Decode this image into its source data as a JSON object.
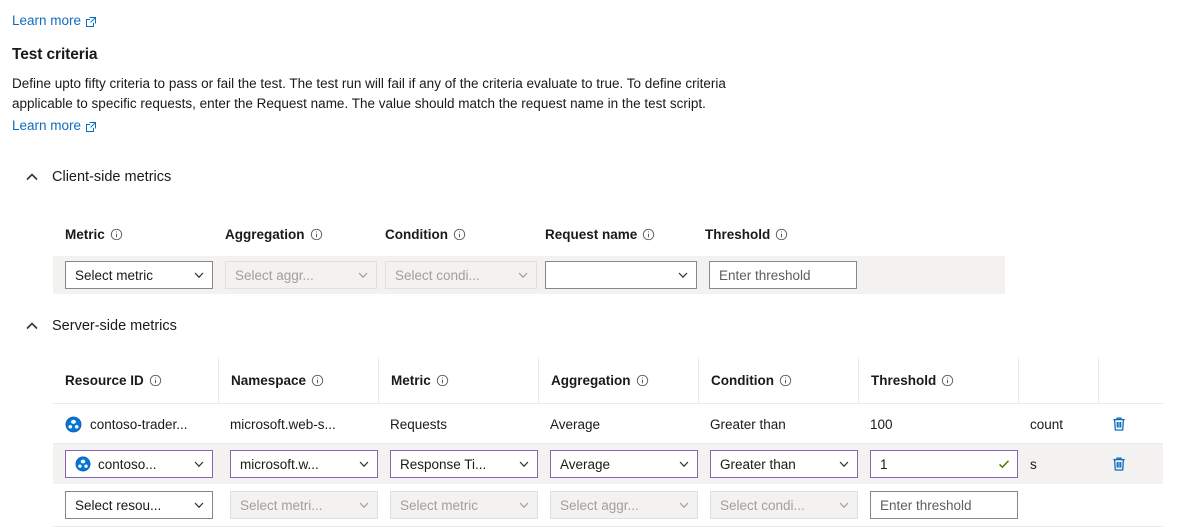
{
  "top_link": {
    "label": "Learn more",
    "icon": "external-link-icon"
  },
  "test_criteria": {
    "title": "Test criteria",
    "description_line1": "Define upto fifty criteria to pass or fail the test. The test run will fail if any of the criteria evaluate to true. To define criteria",
    "description_line2": "applicable to specific requests, enter the Request name. The value should match the request name in the test script.",
    "learn_more_label": "Learn more"
  },
  "client_side": {
    "group_label": "Client-side metrics",
    "chevron": "chevron-up-icon",
    "headers": [
      {
        "label": "Metric",
        "info": "info-icon"
      },
      {
        "label": "Aggregation",
        "info": "info-icon"
      },
      {
        "label": "Condition",
        "info": "info-icon"
      },
      {
        "label": "Request name",
        "info": "info-icon"
      },
      {
        "label": "Threshold",
        "info": "info-icon"
      }
    ],
    "row": {
      "metric": {
        "value": "Select metric",
        "disabled": false,
        "type": "dropdown"
      },
      "aggregation": {
        "value": "Select aggr...",
        "disabled": true,
        "type": "dropdown"
      },
      "condition": {
        "value": "Select condi...",
        "disabled": true,
        "type": "dropdown"
      },
      "request_name": {
        "value": "",
        "disabled": false,
        "type": "dropdown"
      },
      "threshold": {
        "value": "",
        "placeholder": "Enter threshold",
        "disabled": false,
        "type": "text"
      }
    }
  },
  "server_side": {
    "group_label": "Server-side metrics",
    "chevron": "chevron-up-icon",
    "headers": [
      {
        "label": "Resource ID",
        "info": "info-icon"
      },
      {
        "label": "Namespace",
        "info": "info-icon"
      },
      {
        "label": "Metric",
        "info": "info-icon"
      },
      {
        "label": "Aggregation",
        "info": "info-icon"
      },
      {
        "label": "Condition",
        "info": "info-icon"
      },
      {
        "label": "Threshold",
        "info": "info-icon"
      },
      {
        "label": "",
        "info": ""
      },
      {
        "label": "",
        "info": ""
      }
    ],
    "rows": [
      {
        "mode": "readonly",
        "selected": false,
        "resource_icon": "app-service-globe-icon",
        "resource_id": "contoso-trader...",
        "namespace": "microsoft.web-s...",
        "metric": "Requests",
        "aggregation": "Average",
        "condition": "Greater than",
        "threshold": "100",
        "unit": "count",
        "delete_icon": "trash-icon"
      },
      {
        "mode": "editing",
        "selected": true,
        "resource_icon": "app-service-globe-icon",
        "resource_id": "contoso...",
        "namespace": "microsoft.w...",
        "metric": "Response Ti...",
        "aggregation": "Average",
        "condition": "Greater than",
        "threshold": "1",
        "threshold_valid_icon": "checkmark-icon",
        "unit": "s",
        "delete_icon": "trash-icon"
      },
      {
        "mode": "new",
        "selected": false,
        "resource_id": "Select resou...",
        "resource_disabled": false,
        "namespace": "Select metri...",
        "namespace_disabled": true,
        "metric": "Select metric",
        "metric_disabled": true,
        "aggregation": "Select aggr...",
        "aggregation_disabled": true,
        "condition": "Select condi...",
        "condition_disabled": true,
        "threshold_placeholder": "Enter threshold",
        "threshold": "",
        "unit": "",
        "delete_icon": ""
      }
    ]
  },
  "colors": {
    "link": "#0f6cbd",
    "accent_border": "#8764b8",
    "row_selected_bg": "#f3f2f1",
    "valid_check": "#498205",
    "trash": "#0f6cbd",
    "disabled_text": "#a19f9d"
  }
}
